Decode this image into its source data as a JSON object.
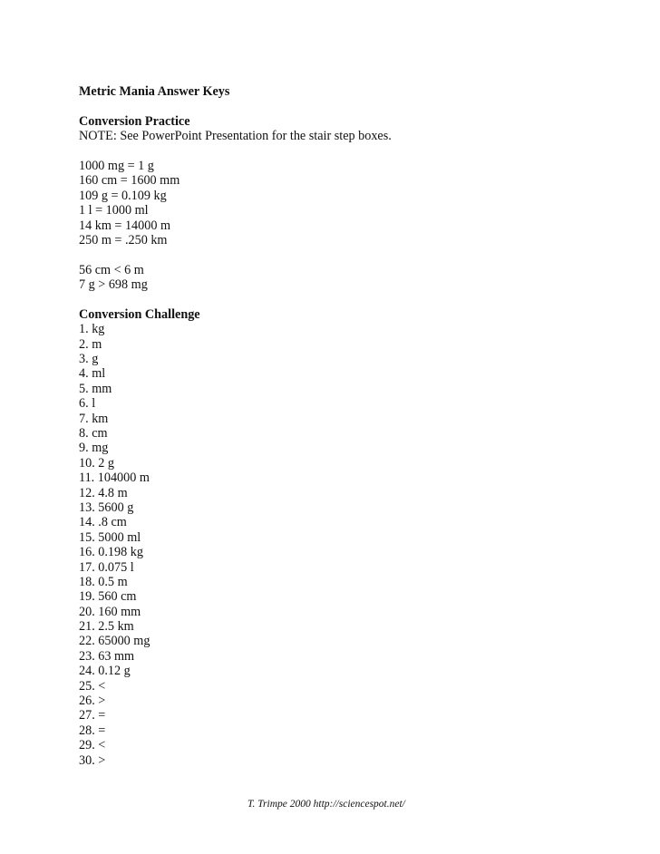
{
  "title": "Metric Mania Answer Keys",
  "practice": {
    "heading": "Conversion Practice",
    "note": "NOTE: See PowerPoint Presentation for the stair step boxes.",
    "conversions": [
      "1000 mg = 1 g",
      "160 cm = 1600 mm",
      "109 g = 0.109 kg",
      "1 l = 1000 ml",
      "14 km = 14000 m",
      "250 m = .250 km"
    ],
    "comparisons": [
      "56 cm < 6 m",
      "7 g > 698 mg"
    ]
  },
  "challenge": {
    "heading": "Conversion Challenge",
    "answers": [
      "1. kg",
      "2. m",
      "3. g",
      "4. ml",
      "5. mm",
      "6. l",
      "7. km",
      "8. cm",
      "9. mg",
      "10. 2 g",
      "11. 104000 m",
      "12. 4.8 m",
      "13. 5600 g",
      "14. .8 cm",
      "15. 5000 ml",
      "16. 0.198 kg",
      "17. 0.075 l",
      "18. 0.5 m",
      "19. 560 cm",
      "20. 160 mm",
      "21. 2.5 km",
      "22. 65000 mg",
      "23. 63 mm",
      "24. 0.12 g",
      "25. <",
      "26. >",
      "27. =",
      "28. =",
      "29. <",
      "30. >"
    ]
  },
  "footer": "T. Trimpe 2000 http://sciencespot.net/"
}
